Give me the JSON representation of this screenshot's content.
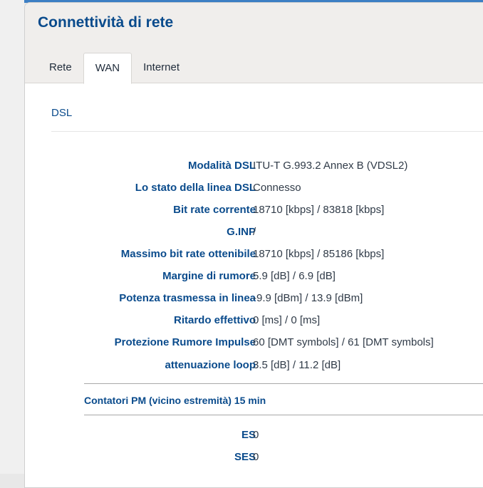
{
  "header": {
    "title": "Connettività di rete"
  },
  "tabs": [
    {
      "label": "Rete",
      "active": false
    },
    {
      "label": "WAN",
      "active": true
    },
    {
      "label": "Internet",
      "active": false
    }
  ],
  "section": {
    "title": "DSL"
  },
  "dsl_rows": [
    {
      "label": "Modalità DSL",
      "value": "ITU-T G.993.2 Annex B (VDSL2)"
    },
    {
      "label": "Lo stato della linea DSL",
      "value": "Connesso"
    },
    {
      "label": "Bit rate corrente",
      "value": "18710 [kbps] / 83818 [kbps]"
    },
    {
      "label": "G.INP",
      "value": "/"
    },
    {
      "label": "Massimo bit rate ottenibile",
      "value": "18710 [kbps] / 85186 [kbps]"
    },
    {
      "label": "Margine di rumore",
      "value": "5.9 [dB] / 6.9 [dB]"
    },
    {
      "label": "Potenza trasmessa in linea",
      "value": "-9.9 [dBm] / 13.9 [dBm]"
    },
    {
      "label": "Ritardo effettivo",
      "value": "0 [ms] / 0 [ms]"
    },
    {
      "label": "Protezione Rumore Impulse",
      "value": "60 [DMT symbols] / 61 [DMT symbols]"
    },
    {
      "label": "attenuazione loop",
      "value": "3.5 [dB] / 11.2 [dB]"
    }
  ],
  "pm_counters": {
    "title": "Contatori PM (vicino estremità) 15 min",
    "rows": [
      {
        "label": "ES",
        "value": "0"
      },
      {
        "label": "SES",
        "value": "0"
      }
    ]
  },
  "colors": {
    "accent": "#0a4b8c",
    "top_bar": "#3d7fc4",
    "header_bg": "#f0eeec",
    "value_text": "#303b48"
  }
}
